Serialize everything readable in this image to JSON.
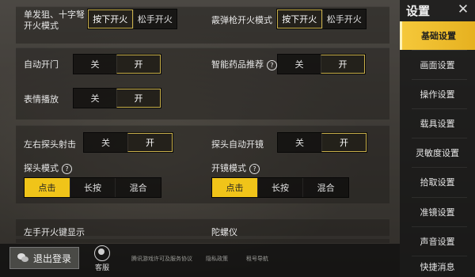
{
  "settings": {
    "row1": {
      "left_label": "单发狙、十字弩\n开火模式",
      "left_options": [
        "按下开火",
        "松手开火"
      ],
      "left_selected": 0,
      "right_label": "霰弹枪开火模式",
      "right_options": [
        "按下开火",
        "松手开火"
      ],
      "right_selected": 0
    },
    "row2": {
      "left_label": "自动开门",
      "left_options": [
        "关",
        "开"
      ],
      "left_selected": 1,
      "right_label": "智能药品推荐",
      "right_help": "?",
      "right_options": [
        "关",
        "开"
      ],
      "right_selected": 1
    },
    "row3": {
      "left_label": "表情播放",
      "left_options": [
        "关",
        "开"
      ],
      "left_selected": 1
    },
    "row4": {
      "left_label": "左右探头射击",
      "left_options": [
        "关",
        "开"
      ],
      "left_selected": 1,
      "right_label": "探头自动开镜",
      "right_options": [
        "关",
        "开"
      ],
      "right_selected": 1
    },
    "row5": {
      "left_label": "探头模式",
      "left_help": "?",
      "left_options": [
        "点击",
        "长按",
        "混合"
      ],
      "left_selected": 0,
      "right_label": "开镜模式",
      "right_help": "?",
      "right_options": [
        "点击",
        "长按",
        "混合"
      ],
      "right_selected": 0
    },
    "row6": {
      "left_label": "左手开火键显示",
      "right_label": "陀螺仪"
    }
  },
  "sidebar": {
    "title": "设置",
    "close": "✕",
    "items": [
      "基础设置",
      "画面设置",
      "操作设置",
      "载具设置",
      "灵敏度设置",
      "拾取设置",
      "准镜设置",
      "声音设置",
      "快捷消息"
    ],
    "active": 0
  },
  "footer": {
    "logout": "退出登录",
    "service": "客服",
    "links": [
      "腾讯游戏许可及服务协议",
      "隐私政策",
      "租号导航"
    ]
  },
  "colors": {
    "accent": "#f0c419",
    "selected_border": "#c9b04a"
  }
}
